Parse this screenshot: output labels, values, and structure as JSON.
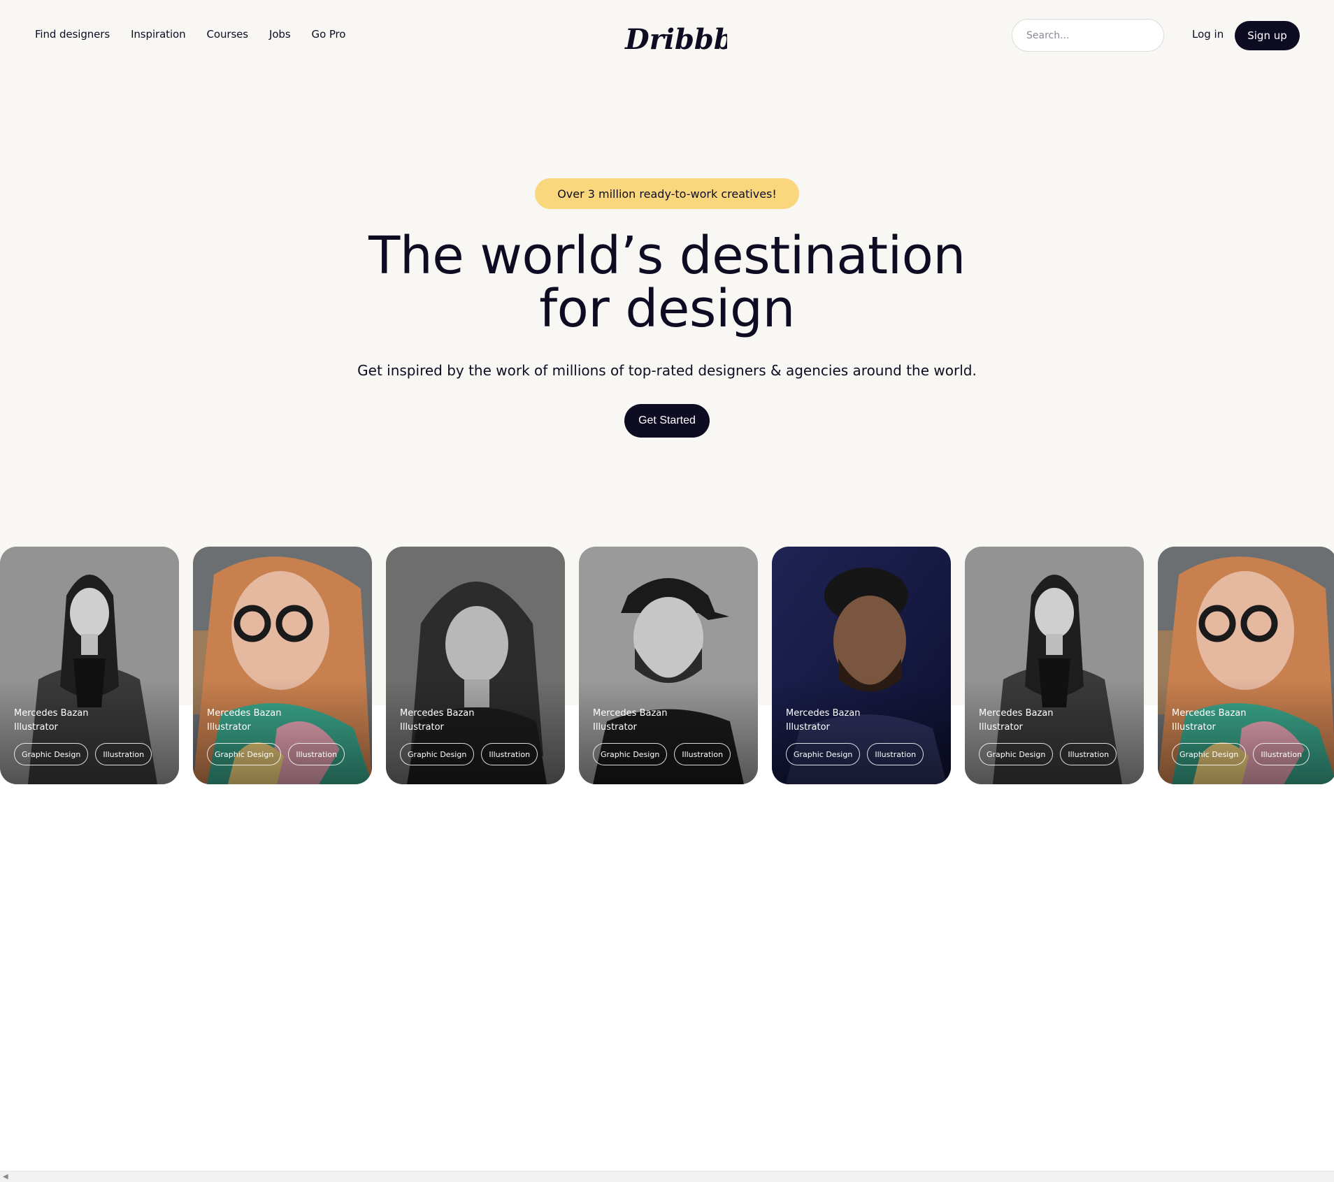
{
  "nav": {
    "links": [
      "Find designers",
      "Inspiration",
      "Courses",
      "Jobs",
      "Go Pro"
    ],
    "logo_text": "Dribbble",
    "search_placeholder": "Search...",
    "login_label": "Log in",
    "signup_label": "Sign up"
  },
  "hero": {
    "badge": "Over 3 million ready-to-work creatives!",
    "headline_line1": "The world’s destination",
    "headline_line2": "for design",
    "subhead": "Get inspired by the work of millions of top-rated designers & agencies around the world.",
    "cta_label": "Get Started"
  },
  "cards": [
    {
      "name": "Mercedes Bazan",
      "role": "Illustrator",
      "tags": [
        "Graphic Design",
        "Illustration"
      ]
    },
    {
      "name": "Mercedes Bazan",
      "role": "Illustrator",
      "tags": [
        "Graphic Design",
        "Illustration"
      ]
    },
    {
      "name": "Mercedes Bazan",
      "role": "Illustrator",
      "tags": [
        "Graphic Design",
        "Illustration"
      ]
    },
    {
      "name": "Mercedes Bazan",
      "role": "Illustrator",
      "tags": [
        "Graphic Design",
        "Illustration"
      ]
    },
    {
      "name": "Mercedes Bazan",
      "role": "Illustrator",
      "tags": [
        "Graphic Design",
        "Illustration"
      ]
    },
    {
      "name": "Mercedes Bazan",
      "role": "Illustrator",
      "tags": [
        "Graphic Design",
        "Illustration"
      ]
    },
    {
      "name": "Mercedes Bazan",
      "role": "Illustrator",
      "tags": [
        "Graphic Design",
        "Illustration"
      ]
    }
  ],
  "colors": {
    "background": "#f8f7f4",
    "badge": "#fad67d",
    "primary_dark": "#0d0c22"
  }
}
